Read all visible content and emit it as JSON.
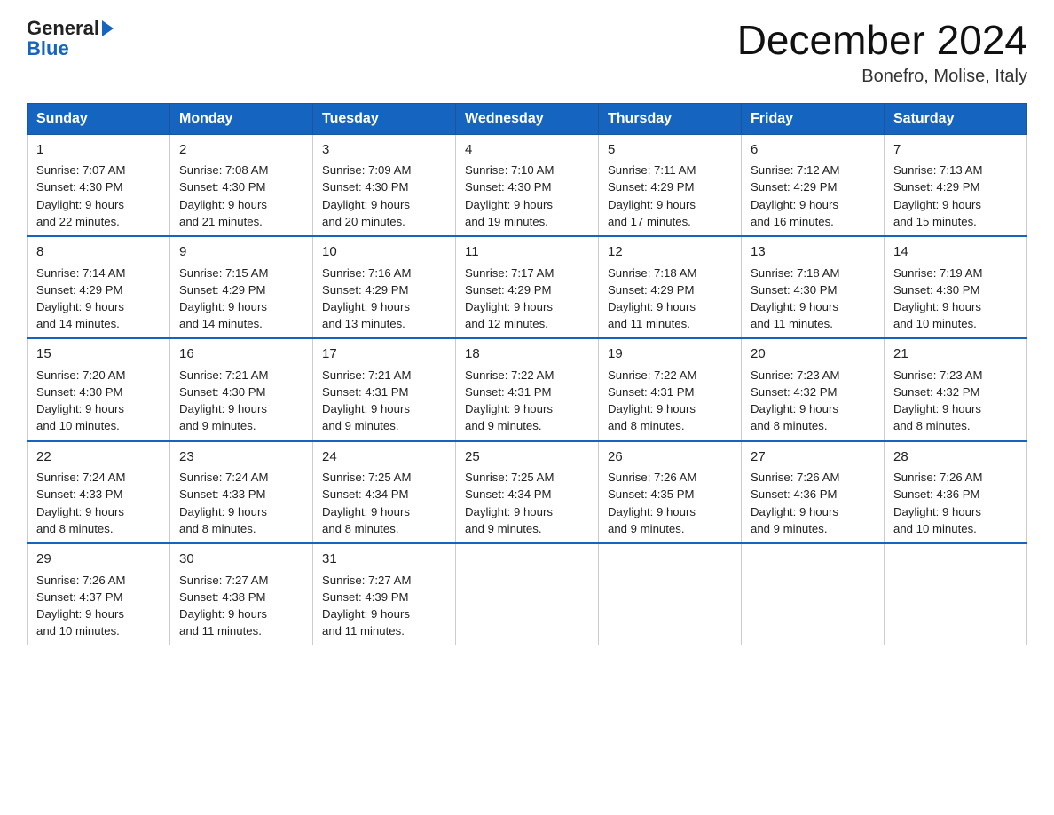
{
  "logo": {
    "general": "General",
    "arrow": "▶",
    "blue": "Blue"
  },
  "header": {
    "month_year": "December 2024",
    "location": "Bonefro, Molise, Italy"
  },
  "days_of_week": [
    "Sunday",
    "Monday",
    "Tuesday",
    "Wednesday",
    "Thursday",
    "Friday",
    "Saturday"
  ],
  "weeks": [
    [
      {
        "day": "1",
        "sunrise": "7:07 AM",
        "sunset": "4:30 PM",
        "daylight": "9 hours and 22 minutes."
      },
      {
        "day": "2",
        "sunrise": "7:08 AM",
        "sunset": "4:30 PM",
        "daylight": "9 hours and 21 minutes."
      },
      {
        "day": "3",
        "sunrise": "7:09 AM",
        "sunset": "4:30 PM",
        "daylight": "9 hours and 20 minutes."
      },
      {
        "day": "4",
        "sunrise": "7:10 AM",
        "sunset": "4:30 PM",
        "daylight": "9 hours and 19 minutes."
      },
      {
        "day": "5",
        "sunrise": "7:11 AM",
        "sunset": "4:29 PM",
        "daylight": "9 hours and 17 minutes."
      },
      {
        "day": "6",
        "sunrise": "7:12 AM",
        "sunset": "4:29 PM",
        "daylight": "9 hours and 16 minutes."
      },
      {
        "day": "7",
        "sunrise": "7:13 AM",
        "sunset": "4:29 PM",
        "daylight": "9 hours and 15 minutes."
      }
    ],
    [
      {
        "day": "8",
        "sunrise": "7:14 AM",
        "sunset": "4:29 PM",
        "daylight": "9 hours and 14 minutes."
      },
      {
        "day": "9",
        "sunrise": "7:15 AM",
        "sunset": "4:29 PM",
        "daylight": "9 hours and 14 minutes."
      },
      {
        "day": "10",
        "sunrise": "7:16 AM",
        "sunset": "4:29 PM",
        "daylight": "9 hours and 13 minutes."
      },
      {
        "day": "11",
        "sunrise": "7:17 AM",
        "sunset": "4:29 PM",
        "daylight": "9 hours and 12 minutes."
      },
      {
        "day": "12",
        "sunrise": "7:18 AM",
        "sunset": "4:29 PM",
        "daylight": "9 hours and 11 minutes."
      },
      {
        "day": "13",
        "sunrise": "7:18 AM",
        "sunset": "4:30 PM",
        "daylight": "9 hours and 11 minutes."
      },
      {
        "day": "14",
        "sunrise": "7:19 AM",
        "sunset": "4:30 PM",
        "daylight": "9 hours and 10 minutes."
      }
    ],
    [
      {
        "day": "15",
        "sunrise": "7:20 AM",
        "sunset": "4:30 PM",
        "daylight": "9 hours and 10 minutes."
      },
      {
        "day": "16",
        "sunrise": "7:21 AM",
        "sunset": "4:30 PM",
        "daylight": "9 hours and 9 minutes."
      },
      {
        "day": "17",
        "sunrise": "7:21 AM",
        "sunset": "4:31 PM",
        "daylight": "9 hours and 9 minutes."
      },
      {
        "day": "18",
        "sunrise": "7:22 AM",
        "sunset": "4:31 PM",
        "daylight": "9 hours and 9 minutes."
      },
      {
        "day": "19",
        "sunrise": "7:22 AM",
        "sunset": "4:31 PM",
        "daylight": "9 hours and 8 minutes."
      },
      {
        "day": "20",
        "sunrise": "7:23 AM",
        "sunset": "4:32 PM",
        "daylight": "9 hours and 8 minutes."
      },
      {
        "day": "21",
        "sunrise": "7:23 AM",
        "sunset": "4:32 PM",
        "daylight": "9 hours and 8 minutes."
      }
    ],
    [
      {
        "day": "22",
        "sunrise": "7:24 AM",
        "sunset": "4:33 PM",
        "daylight": "9 hours and 8 minutes."
      },
      {
        "day": "23",
        "sunrise": "7:24 AM",
        "sunset": "4:33 PM",
        "daylight": "9 hours and 8 minutes."
      },
      {
        "day": "24",
        "sunrise": "7:25 AM",
        "sunset": "4:34 PM",
        "daylight": "9 hours and 8 minutes."
      },
      {
        "day": "25",
        "sunrise": "7:25 AM",
        "sunset": "4:34 PM",
        "daylight": "9 hours and 9 minutes."
      },
      {
        "day": "26",
        "sunrise": "7:26 AM",
        "sunset": "4:35 PM",
        "daylight": "9 hours and 9 minutes."
      },
      {
        "day": "27",
        "sunrise": "7:26 AM",
        "sunset": "4:36 PM",
        "daylight": "9 hours and 9 minutes."
      },
      {
        "day": "28",
        "sunrise": "7:26 AM",
        "sunset": "4:36 PM",
        "daylight": "9 hours and 10 minutes."
      }
    ],
    [
      {
        "day": "29",
        "sunrise": "7:26 AM",
        "sunset": "4:37 PM",
        "daylight": "9 hours and 10 minutes."
      },
      {
        "day": "30",
        "sunrise": "7:27 AM",
        "sunset": "4:38 PM",
        "daylight": "9 hours and 11 minutes."
      },
      {
        "day": "31",
        "sunrise": "7:27 AM",
        "sunset": "4:39 PM",
        "daylight": "9 hours and 11 minutes."
      },
      null,
      null,
      null,
      null
    ]
  ],
  "labels": {
    "sunrise": "Sunrise:",
    "sunset": "Sunset:",
    "daylight": "Daylight:"
  }
}
